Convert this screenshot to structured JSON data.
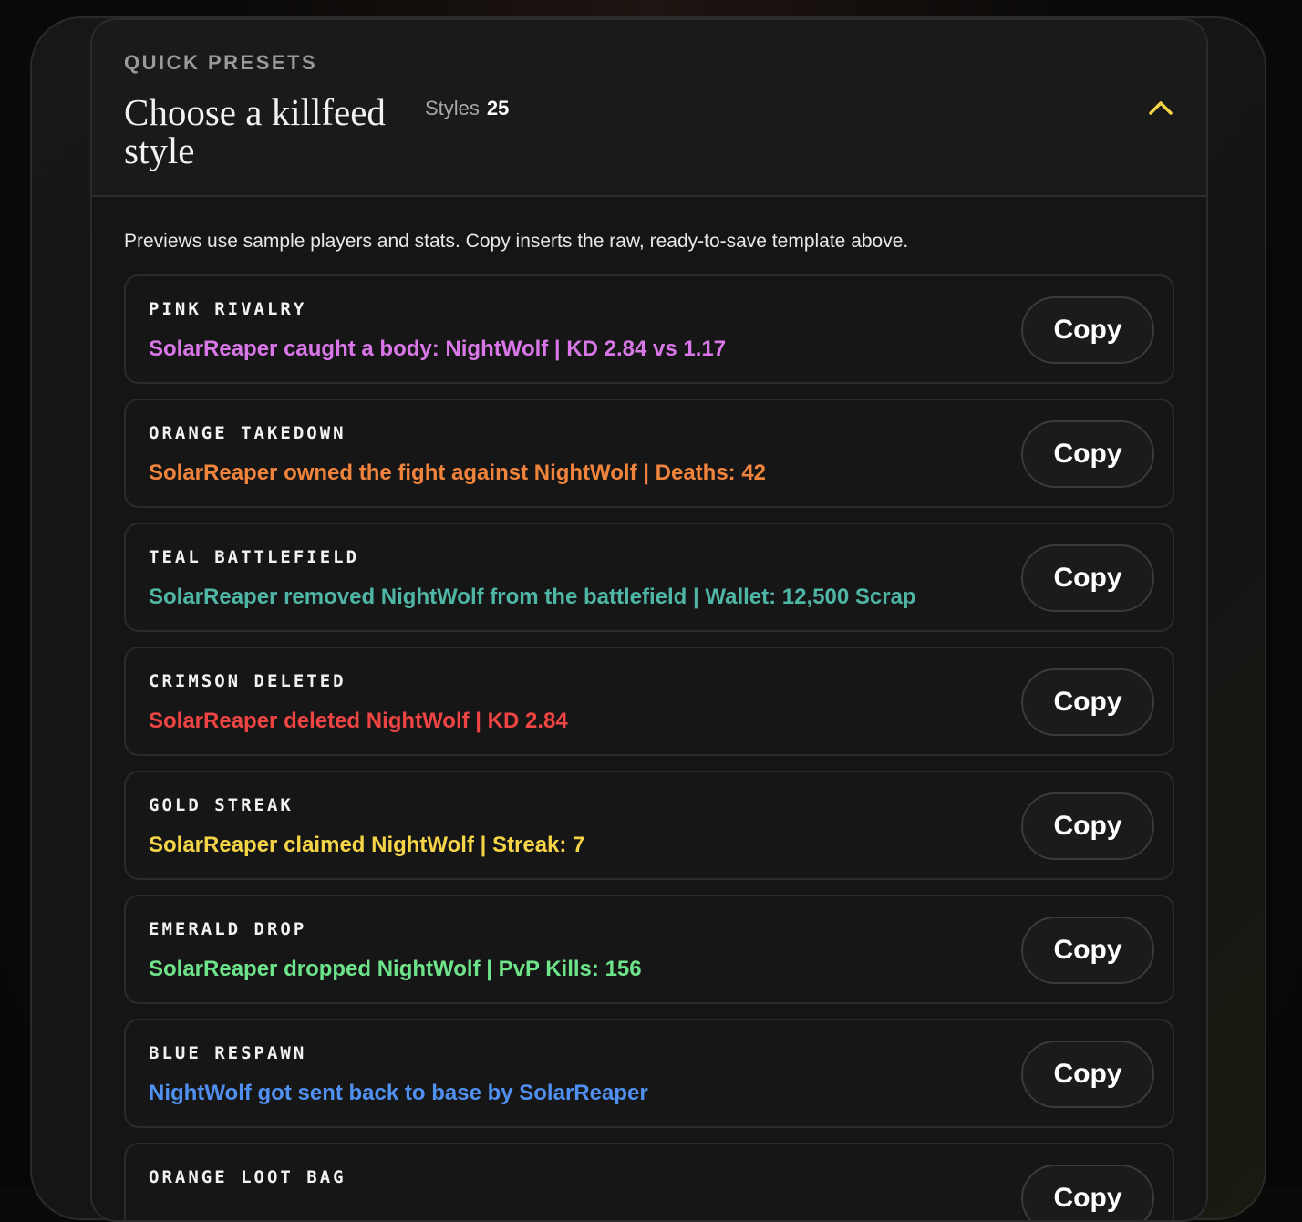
{
  "header": {
    "eyebrow": "QUICK PRESETS",
    "title": "Choose a killfeed style",
    "styles_label": "Styles",
    "styles_count": "25",
    "collapse_icon": "chevron-up-icon",
    "accent_color": "#f5d547"
  },
  "intro": "Previews use sample players and stats. Copy inserts the raw, ready-to-save template above.",
  "presets": [
    {
      "name": "PINK RIVALRY",
      "preview": "SolarReaper caught a body: NightWolf | KD 2.84 vs 1.17",
      "color": "#d977e8",
      "copy_label": "Copy"
    },
    {
      "name": "ORANGE TAKEDOWN",
      "preview": "SolarReaper owned the fight against NightWolf | Deaths: 42",
      "color": "#f0843c",
      "copy_label": "Copy"
    },
    {
      "name": "TEAL BATTLEFIELD",
      "preview": "SolarReaper removed NightWolf from the battlefield | Wallet: 12,500 Scrap",
      "color": "#4fb6a6",
      "copy_label": "Copy"
    },
    {
      "name": "CRIMSON DELETED",
      "preview": "SolarReaper deleted NightWolf | KD 2.84",
      "color": "#ef4444",
      "copy_label": "Copy"
    },
    {
      "name": "GOLD STREAK",
      "preview": "SolarReaper claimed NightWolf | Streak: 7",
      "color": "#f5d547",
      "copy_label": "Copy"
    },
    {
      "name": "EMERALD DROP",
      "preview": "SolarReaper dropped NightWolf | PvP Kills: 156",
      "color": "#6de38a",
      "copy_label": "Copy"
    },
    {
      "name": "BLUE RESPAWN",
      "preview": "NightWolf got sent back to base by SolarReaper",
      "color": "#4f90f0",
      "copy_label": "Copy"
    },
    {
      "name": "ORANGE LOOT BAG",
      "preview": "",
      "color": "#f0843c",
      "copy_label": "Copy"
    }
  ]
}
